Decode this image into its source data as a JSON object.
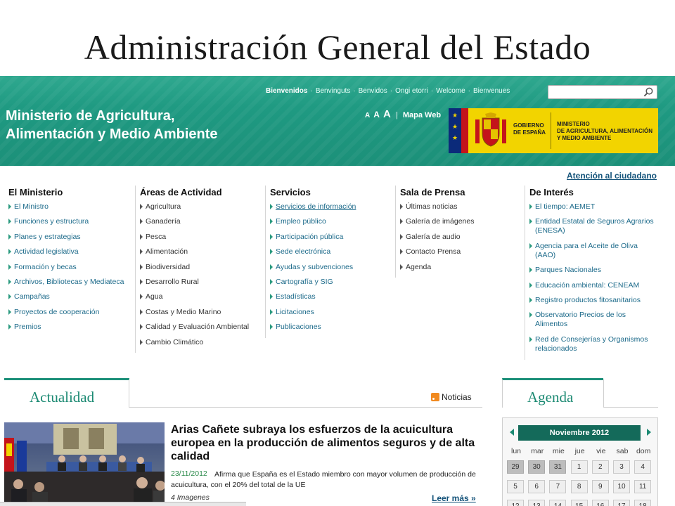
{
  "slide": {
    "title": "Administración General del Estado"
  },
  "header": {
    "languages": [
      "Bienvenidos",
      "Benvinguts",
      "Benvidos",
      "Ongi etorri",
      "Welcome",
      "Bienvenues"
    ],
    "search_placeholder": "",
    "ministry_line1": "Ministerio de Agricultura,",
    "ministry_line2": "Alimentación y Medio Ambiente",
    "font_small": "A",
    "font_medium": "A",
    "font_large": "A",
    "font_sep": "|",
    "site_map": "Mapa Web",
    "gov_text_line1": "GOBIERNO",
    "gov_text_line2": "DE ESPAÑA",
    "ministry_logo_line1": "MINISTERIO",
    "ministry_logo_line2": "DE AGRICULTURA, ALIMENTACIÓN",
    "ministry_logo_line3": "Y MEDIO AMBIENTE",
    "colors": {
      "header_green": "#1f9a82",
      "logo_yellow": "#f2d400"
    }
  },
  "atencion": "Atención al ciudadano",
  "nav": [
    {
      "title": "El Ministerio",
      "items": [
        "El Ministro",
        "Funciones y estructura",
        "Planes y estrategias",
        "Actividad legislativa",
        "Formación y becas",
        "Archivos, Bibliotecas y Mediateca",
        "Campañas",
        "Proyectos de cooperación",
        "Premios"
      ]
    },
    {
      "title": "Áreas de Actividad",
      "items": [
        "Agricultura",
        "Ganadería",
        "Pesca",
        "Alimentación",
        "Biodiversidad",
        "Desarrollo Rural",
        "Agua",
        "Costas y Medio Marino",
        "Calidad y Evaluación Ambiental",
        "Cambio Climático"
      ]
    },
    {
      "title": "Servicios",
      "items": [
        "Servicios de información",
        "Empleo público",
        "Participación pública",
        "Sede electrónica",
        "Ayudas y subvenciones",
        "Cartografía y SIG",
        "Estadísticas",
        "Licitaciones",
        "Publicaciones"
      ]
    },
    {
      "title": "Sala de Prensa",
      "items": [
        "Últimas noticias",
        "Galería de imágenes",
        "Galería de audio",
        "Contacto Prensa",
        "Agenda"
      ]
    },
    {
      "title": "De Interés",
      "items": [
        "El tiempo: AEMET",
        "Entidad Estatal de Seguros Agrarios (ENESA)",
        "Agencia para el Aceite de Oliva (AAO)",
        "Parques Nacionales",
        "Educación ambiental: CENEAM",
        "Registro productos fitosanitarios",
        "Observatorio Precios de los Alimentos",
        "Red de Consejerías y Organismos relacionados"
      ]
    }
  ],
  "actualidad": {
    "tab": "Actualidad",
    "rss_label": "Noticias",
    "headline": "Arias Cañete subraya los esfuerzos de la acuicultura europea en la producción de alimentos seguros y de alta calidad",
    "date": "23/11/2012",
    "summary": "Afirma que España es el Estado miembro con mayor volumen de producción de acuicultura, con el 20% del total de la UE",
    "images": "4 Imagenes",
    "read_more": "Leer más »"
  },
  "agenda": {
    "tab": "Agenda",
    "month": "Noviembre 2012",
    "weekdays": [
      "lun",
      "mar",
      "mie",
      "jue",
      "vie",
      "sab",
      "dom"
    ],
    "weeks": [
      [
        "29",
        "30",
        "31",
        "1",
        "2",
        "3",
        "4"
      ],
      [
        "5",
        "6",
        "7",
        "8",
        "9",
        "10",
        "11"
      ],
      [
        "12",
        "13",
        "14",
        "15",
        "16",
        "17",
        "18"
      ]
    ],
    "past_days_in_first_week": 3
  }
}
